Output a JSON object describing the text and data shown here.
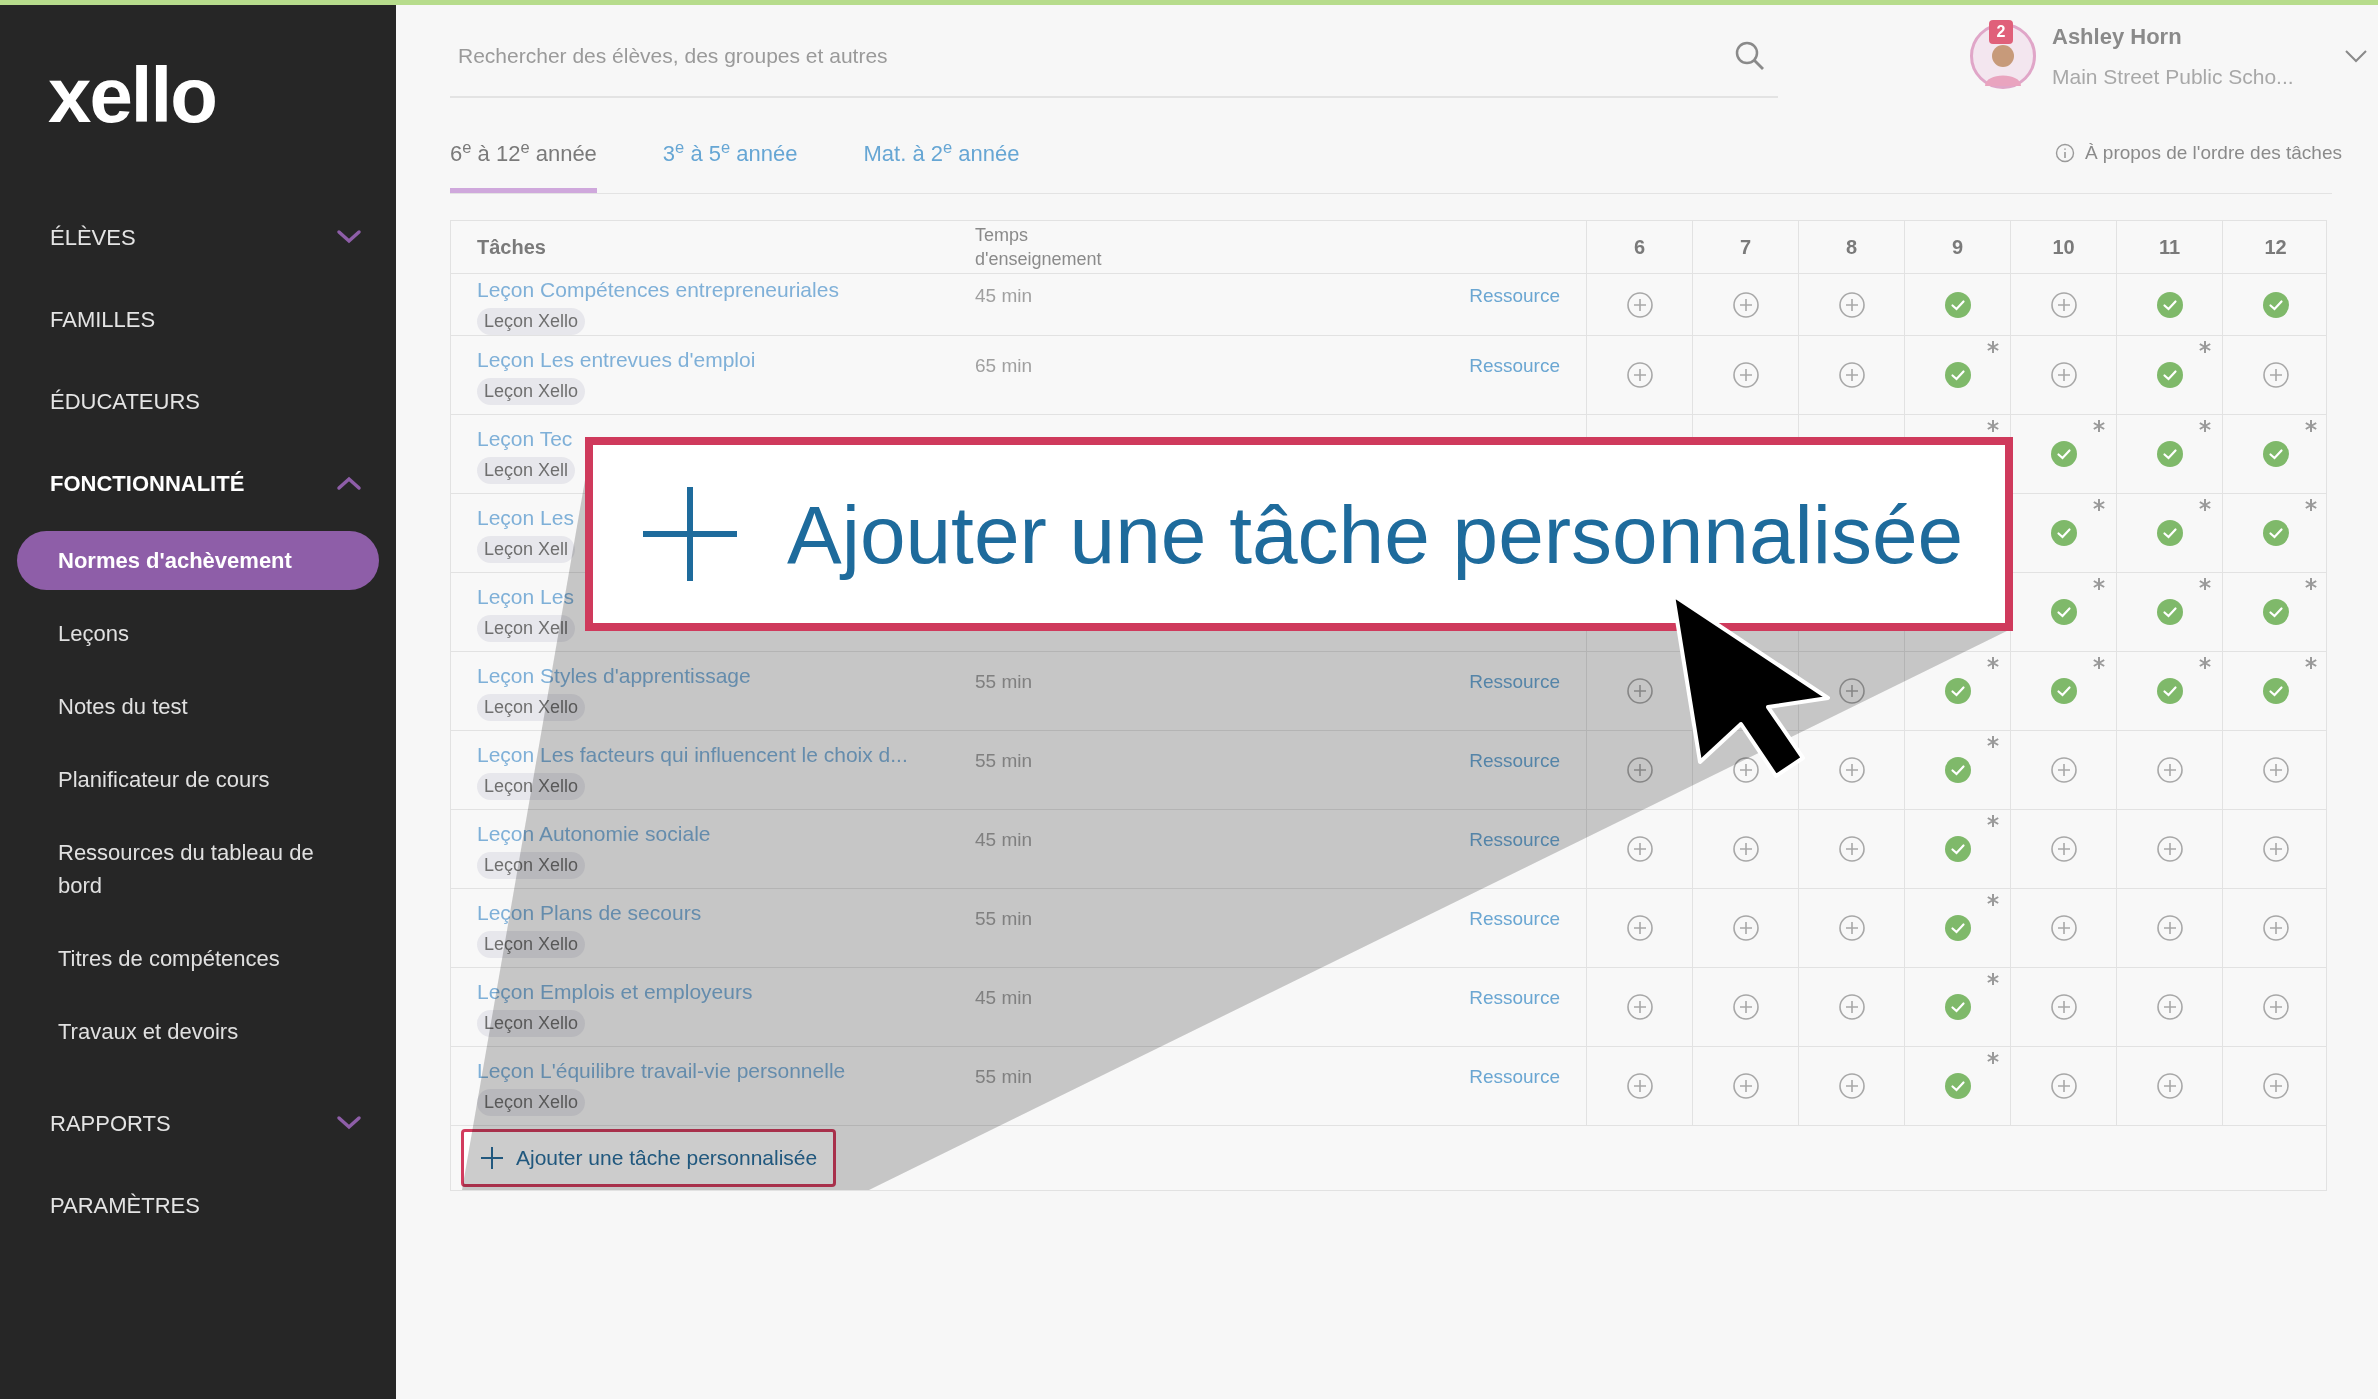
{
  "logo": "xello",
  "nav": [
    {
      "label": "ÉLÈVES",
      "expanded": false
    },
    {
      "label": "FAMILLES"
    },
    {
      "label": "ÉDUCATEURS"
    },
    {
      "label": "FONCTIONNALITÉ",
      "expanded": true,
      "children": [
        {
          "label": "Normes d'achèvement",
          "selected": true
        },
        {
          "label": "Leçons",
          "selected": false
        },
        {
          "label": "Notes du test",
          "selected": false
        },
        {
          "label": "Planificateur de cours",
          "selected": false
        },
        {
          "label": "Ressources du tableau de bord",
          "selected": false
        },
        {
          "label": "Titres de compétences",
          "selected": false
        },
        {
          "label": "Travaux et devoirs",
          "selected": false
        }
      ]
    },
    {
      "label": "RAPPORTS",
      "expanded": false
    },
    {
      "label": "PARAMÈTRES"
    }
  ],
  "search": {
    "placeholder": "Rechercher des élèves, des groupes et autres"
  },
  "user": {
    "badge": "2",
    "name": "Ashley Horn",
    "school": "Main Street Public Scho..."
  },
  "tabs": [
    {
      "label": "6$^{e}$ à 12$^{e}$ année",
      "selected": true
    },
    {
      "label": "3$^{e}$ à 5$^{e}$ année",
      "selected": false
    },
    {
      "label": "Mat. à 2$^{e}$ année",
      "selected": false
    }
  ],
  "info_link": "À propos de l'ordre des tâches",
  "table": {
    "columns": [
      "Tâches",
      "Temps d'enseignement"
    ],
    "grades": [
      "6",
      "7",
      "8",
      "9",
      "10",
      "11",
      "12"
    ],
    "rows": [
      {
        "title": "Leçon Compétences entrepreneuriales",
        "badge": "Leçon Xello",
        "time": "45 min",
        "resource": "Ressource",
        "cells": [
          {
            "kind": "plus"
          },
          {
            "kind": "plus"
          },
          {
            "kind": "plus"
          },
          {
            "kind": "check"
          },
          {
            "kind": "plus"
          },
          {
            "kind": "check"
          },
          {
            "kind": "check"
          }
        ]
      },
      {
        "title": "Leçon Les entrevues d'emploi",
        "badge": "Leçon Xello",
        "time": "65 min",
        "resource": "Ressource",
        "cells": [
          {
            "kind": "plus",
            "starred": false
          },
          {
            "kind": "plus",
            "starred": false
          },
          {
            "kind": "plus",
            "starred": false
          },
          {
            "kind": "check",
            "starred": true
          },
          {
            "kind": "plus",
            "starred": false
          },
          {
            "kind": "check",
            "starred": true
          },
          {
            "kind": "plus",
            "starred": false
          }
        ]
      },
      {
        "title": "Leçon Tec",
        "badge": "Leçon Xell",
        "cells": [
          {
            "kind": "empty"
          },
          {
            "kind": "empty"
          },
          {
            "kind": "empty"
          },
          {
            "kind": "empty",
            "starred": true
          },
          {
            "kind": "check",
            "starred": true
          },
          {
            "kind": "check",
            "starred": true
          },
          {
            "kind": "check",
            "starred": true
          }
        ]
      },
      {
        "title": "Leçon Les",
        "badge": "Leçon Xell",
        "cells": [
          {
            "kind": "empty"
          },
          {
            "kind": "empty"
          },
          {
            "kind": "empty"
          },
          {
            "kind": "empty"
          },
          {
            "kind": "check",
            "starred": true
          },
          {
            "kind": "check",
            "starred": true
          },
          {
            "kind": "check",
            "starred": true
          }
        ]
      },
      {
        "title": "Leçon Les",
        "badge": "Leçon Xell",
        "cells": [
          {
            "kind": "empty"
          },
          {
            "kind": "empty"
          },
          {
            "kind": "empty"
          },
          {
            "kind": "empty"
          },
          {
            "kind": "check",
            "starred": true
          },
          {
            "kind": "check",
            "starred": true
          },
          {
            "kind": "check",
            "starred": true
          }
        ]
      },
      {
        "title": "Leçon Styles d'apprentissage",
        "badge": "Leçon Xello",
        "time": "55 min",
        "resource": "Ressource",
        "cells": [
          {
            "kind": "plus",
            "starred": false
          },
          {
            "kind": "empty"
          },
          {
            "kind": "plus",
            "starred": false
          },
          {
            "kind": "check",
            "starred": true
          },
          {
            "kind": "check",
            "starred": true
          },
          {
            "kind": "check",
            "starred": true
          },
          {
            "kind": "check",
            "starred": true
          }
        ]
      },
      {
        "title": "Leçon Les facteurs qui influencent le choix d...",
        "badge": "Leçon Xello",
        "time": "55 min",
        "resource": "Ressource",
        "cells": [
          {
            "kind": "plus",
            "starred": false
          },
          {
            "kind": "plus"
          },
          {
            "kind": "plus",
            "starred": false
          },
          {
            "kind": "check",
            "starred": true
          },
          {
            "kind": "plus",
            "starred": false
          },
          {
            "kind": "plus",
            "starred": false
          },
          {
            "kind": "plus",
            "starred": false
          }
        ]
      },
      {
        "title": "Leçon Autonomie sociale",
        "badge": "Leçon Xello",
        "time": "45 min",
        "resource": "Ressource",
        "cells": [
          {
            "kind": "plus",
            "starred": false
          },
          {
            "kind": "plus",
            "starred": false
          },
          {
            "kind": "plus",
            "starred": false
          },
          {
            "kind": "check",
            "starred": true
          },
          {
            "kind": "plus",
            "starred": false
          },
          {
            "kind": "plus",
            "starred": false
          },
          {
            "kind": "plus",
            "starred": false
          }
        ]
      },
      {
        "title": "Leçon Plans de secours",
        "badge": "Leçon Xello",
        "time": "55 min",
        "resource": "Ressource",
        "cells": [
          {
            "kind": "plus",
            "starred": false
          },
          {
            "kind": "plus",
            "starred": false
          },
          {
            "kind": "plus",
            "starred": false
          },
          {
            "kind": "check",
            "starred": true
          },
          {
            "kind": "plus",
            "starred": false
          },
          {
            "kind": "plus",
            "starred": false
          },
          {
            "kind": "plus",
            "starred": false
          }
        ]
      },
      {
        "title": "Leçon Emplois et employeurs",
        "badge": "Leçon Xello",
        "time": "45 min",
        "resource": "Ressource",
        "cells": [
          {
            "kind": "plus",
            "starred": false
          },
          {
            "kind": "plus",
            "starred": false
          },
          {
            "kind": "plus",
            "starred": false
          },
          {
            "kind": "check",
            "starred": true
          },
          {
            "kind": "plus",
            "starred": false
          },
          {
            "kind": "plus",
            "starred": false
          },
          {
            "kind": "plus",
            "starred": false
          }
        ]
      },
      {
        "title": "Leçon L'équilibre travail-vie personnelle",
        "badge": "Leçon Xello",
        "time": "55 min",
        "resource": "Ressource",
        "cells": [
          {
            "kind": "plus",
            "starred": false
          },
          {
            "kind": "plus",
            "starred": false
          },
          {
            "kind": "plus",
            "starred": false
          },
          {
            "kind": "check",
            "starred": true
          },
          {
            "kind": "plus",
            "starred": false
          },
          {
            "kind": "plus",
            "starred": false
          },
          {
            "kind": "plus",
            "starred": false
          }
        ]
      }
    ],
    "add_button": "Ajouter une tâche personnalisée"
  },
  "callout": {
    "label": "Ajouter une tâche personnalisée"
  }
}
